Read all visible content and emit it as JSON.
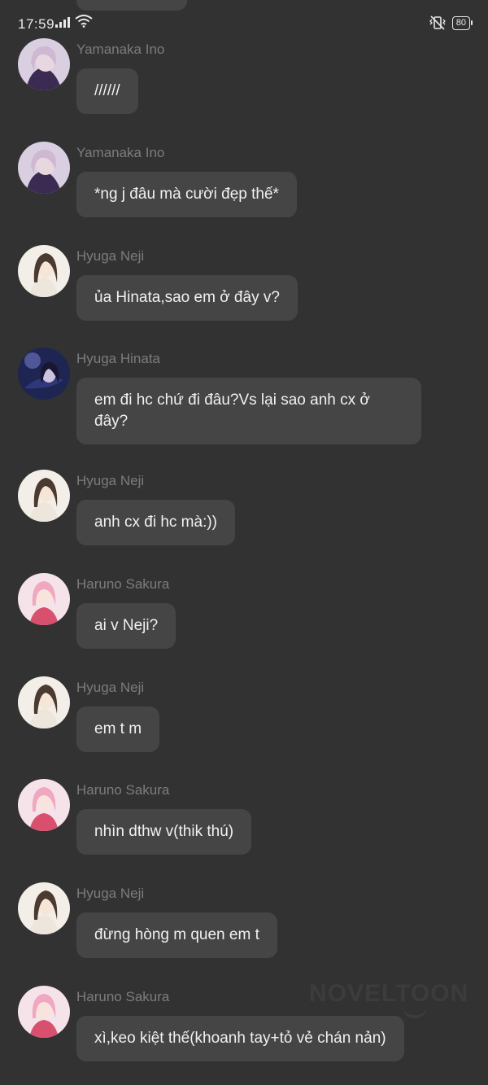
{
  "status_bar": {
    "time": "17:59",
    "battery": "80",
    "icons": [
      "signal-icon",
      "wifi-icon",
      "vibrate-off-icon",
      "battery-icon"
    ]
  },
  "messages": [
    {
      "name": "Yamanaka Ino",
      "text": "//////",
      "avatar": "ino"
    },
    {
      "name": "Yamanaka Ino",
      "text": "*ng j đâu mà cười đẹp thế*",
      "avatar": "ino"
    },
    {
      "name": "Hyuga Neji",
      "text": "ủa Hinata,sao em ở đây v?",
      "avatar": "neji"
    },
    {
      "name": "Hyuga Hinata",
      "text": "em đi hc chứ đi đâu?Vs lại sao anh cx ở đây?",
      "avatar": "hinata"
    },
    {
      "name": "Hyuga Neji",
      "text": "anh cx đi hc mà:))",
      "avatar": "neji"
    },
    {
      "name": "Haruno Sakura",
      "text": "ai v Neji?",
      "avatar": "sakura"
    },
    {
      "name": "Hyuga Neji",
      "text": "em t m",
      "avatar": "neji"
    },
    {
      "name": "Haruno Sakura",
      "text": "nhìn dthw v(thik thú)",
      "avatar": "sakura"
    },
    {
      "name": "Hyuga Neji",
      "text": "đừng hòng m quen em t",
      "avatar": "neji"
    },
    {
      "name": "Haruno Sakura",
      "text": "xì,keo kiệt thế(khoanh tay+tỏ vẻ chán nản)",
      "avatar": "sakura"
    }
  ],
  "watermark": "NOVELTOON",
  "colors": {
    "background": "#323232",
    "bubble": "#454545",
    "name": "#7c7c7c",
    "text": "#f1f1f1"
  }
}
